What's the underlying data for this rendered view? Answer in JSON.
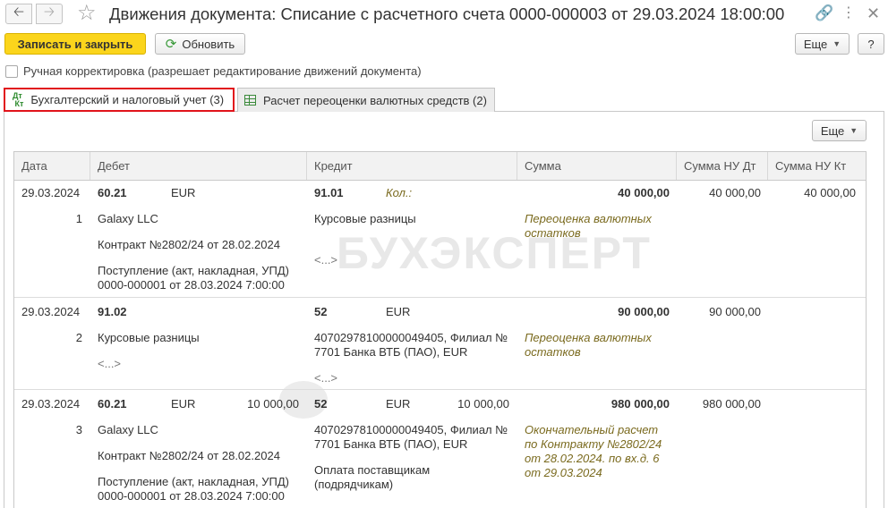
{
  "window": {
    "title": "Движения документа: Списание с расчетного счета 0000-000003 от 29.03.2024 18:00:00"
  },
  "toolbar": {
    "save_close_label": "Записать и закрыть",
    "refresh_label": "Обновить",
    "more_label": "Еще",
    "help_label": "?"
  },
  "manual_adjust_label": "Ручная корректировка (разрешает редактирование движений документа)",
  "tabs": [
    {
      "label": "Бухгалтерский и налоговый учет (3)",
      "icon_text": "Дт Кт"
    },
    {
      "label": "Расчет переоценки валютных средств (2)"
    }
  ],
  "panel_more_label": "Еще",
  "watermark": "БУХЭКСПЕРТ",
  "table": {
    "columns": [
      "Дата",
      "Дебет",
      "Кредит",
      "Сумма",
      "Сумма НУ Дт",
      "Сумма НУ Кт"
    ],
    "rows": [
      {
        "date": "29.03.2024",
        "num": "1",
        "dt_account": "60.21",
        "dt_currency": "EUR",
        "dt_amount": "",
        "dt_sub1": "Galaxy LLC",
        "dt_sub2": "Контракт №2802/24 от 28.02.2024",
        "dt_sub3": "Поступление (акт, накладная, УПД) 0000-000001 от 28.03.2024 7:00:00",
        "kt_account": "91.01",
        "kt_extra": "Кол.:",
        "kt_currency": "",
        "kt_amount": "",
        "kt_sub1": "Курсовые разницы",
        "kt_sub2": "",
        "kt_sub3": "<...>",
        "sum": "40 000,00",
        "content": "Переоценка валютных остатков",
        "nu_dt": "40 000,00",
        "nu_kt": "40 000,00"
      },
      {
        "date": "29.03.2024",
        "num": "2",
        "dt_account": "91.02",
        "dt_currency": "",
        "dt_amount": "",
        "dt_sub1": "Курсовые разницы",
        "dt_sub2": "<...>",
        "dt_sub3": "",
        "kt_account": "52",
        "kt_extra": "",
        "kt_currency": "EUR",
        "kt_amount": "",
        "kt_sub1": "40702978100000049405, Филиал № 7701 Банка ВТБ (ПАО), EUR",
        "kt_sub2": "",
        "kt_sub3": "<...>",
        "sum": "90 000,00",
        "content": "Переоценка валютных остатков",
        "nu_dt": "90 000,00",
        "nu_kt": ""
      },
      {
        "date": "29.03.2024",
        "num": "3",
        "dt_account": "60.21",
        "dt_currency": "EUR",
        "dt_amount": "10 000,00",
        "dt_sub1": "Galaxy LLC",
        "dt_sub2": "Контракт №2802/24 от 28.02.2024",
        "dt_sub3": "Поступление (акт, накладная, УПД) 0000-000001 от 28.03.2024 7:00:00",
        "kt_account": "52",
        "kt_extra": "",
        "kt_currency": "EUR",
        "kt_amount": "10 000,00",
        "kt_sub1": "40702978100000049405, Филиал № 7701 Банка ВТБ (ПАО), EUR",
        "kt_sub2": "",
        "kt_sub3": "Оплата поставщикам (подрядчикам)",
        "sum": "980 000,00",
        "content": "Окончательный расчет по Контракту №2802/24 от 28.02.2024. по вх.д. 6 от 29.03.2024",
        "nu_dt": "980 000,00",
        "nu_kt": ""
      }
    ]
  },
  "colors": {
    "primary_button": "#fbd51c",
    "active_tab_border": "#e1141b",
    "content_text": "#7a6a1e"
  }
}
